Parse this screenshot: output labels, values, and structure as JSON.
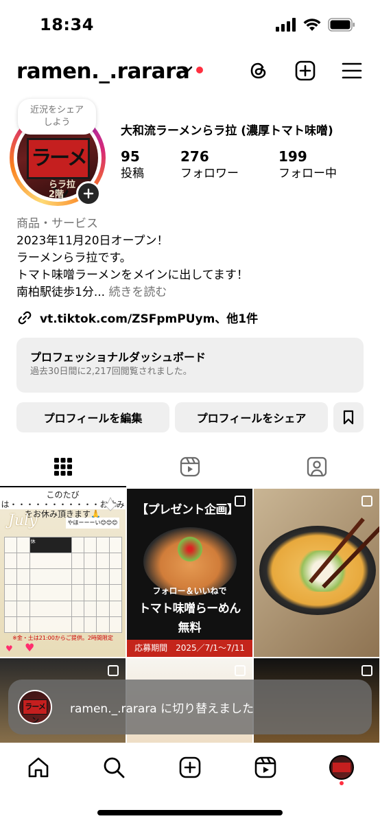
{
  "status_bar": {
    "time": "18:34"
  },
  "header": {
    "username": "ramen._.rarara"
  },
  "profile": {
    "note_line1": "近況をシェア",
    "note_line2": "しよう",
    "avatar_sign": "ラーメン",
    "avatar_sub": "らラ拉\n2階",
    "display_name": "大和流ラーメンらラ拉 (濃厚トマト味噌)",
    "stats": [
      {
        "number": "95",
        "label": "投稿"
      },
      {
        "number": "276",
        "label": "フォロワー"
      },
      {
        "number": "199",
        "label": "フォロー中"
      }
    ],
    "category": "商品・サービス",
    "bio_lines": [
      "2023年11月20日オープン！",
      "ラーメンらラ拉です。",
      "トマト味噌ラーメンをメインに出してます！",
      "南柏駅徒歩1分..."
    ],
    "bio_more": "続きを読む",
    "link": "vt.tiktok.com/ZSFpmPUym、他1件"
  },
  "dashboard": {
    "title": "プロフェッショナルダッシュボード",
    "subtitle": "過去30日間に2,217回閲覧されました。"
  },
  "buttons": {
    "edit": "プロフィールを編集",
    "share": "プロフィールをシェア"
  },
  "posts": {
    "p1_top1": "このたびは・・・・・・・・・・・お休み",
    "p1_top2": "をお休み頂きます🙏",
    "p1_title": "July",
    "p1_note": "やほーーーい😊😊😊",
    "p1_footer": "※金・土は21:00からご提供。2時間限定",
    "p2_title": "【プレゼント企画】",
    "p2_sub": "フォロー＆いいねで",
    "p2_main": "トマト味噌らーめん",
    "p2_free": "無料",
    "p2_period": "応募期間　2025／7/1〜7/11"
  },
  "toast": {
    "message": "ramen._.rarara に切り替えました",
    "avatar_text": "ラーメン"
  }
}
